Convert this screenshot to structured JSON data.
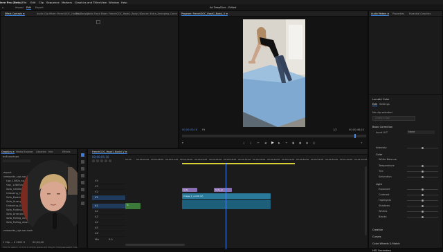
{
  "menubar": {
    "app_title": "iere Pro (Beta)",
    "items": [
      "File",
      "Edit",
      "Clip",
      "Sequence",
      "Markers",
      "Graphics and Titles",
      "View",
      "Window",
      "Help"
    ]
  },
  "appbar": {
    "import": "Import",
    "edit": "Edit",
    "export": "Export",
    "project_title": "Ad DeepDive - Edited"
  },
  "source_tabs": [
    "Effect Controls ≡",
    "Audio Clip Mixer: FrenchGOC_Hook1_Bodyl_V",
    "Text",
    "Audio Track Mixer: FrenchGOC_Hook1_Bodyl_V",
    "Source: Extra_Arranging_Conm"
  ],
  "program": {
    "tab": "Program: FrenchGOC_Hook1_Bodyl_V ≡",
    "timecode_left": "00;00;05;16",
    "fit": "Fit",
    "timecode_right": "00;00;48;14",
    "ratio": "1/2"
  },
  "right_tabs": [
    "Audio Meters ≡",
    "Properties",
    "Essential Graphics"
  ],
  "lumetri": {
    "heading": "Lumetri Color",
    "tabs": [
      "Edit",
      "Settings"
    ],
    "no_clip": "No clip selected",
    "create_look": "Create a look",
    "section_basic": "Basic Correction",
    "input_lut": "Input LUT",
    "input_lut_value": "None",
    "intensity": "Intensity",
    "color": "Color",
    "white_balance": "White Balance",
    "temperature": "Temperature",
    "tint": "Tint",
    "saturation": "Saturation",
    "light": "Light",
    "light_rows": [
      "Exposure",
      "Contrast",
      "Highlights",
      "Shadows",
      "Whites",
      "Blacks"
    ],
    "sections": [
      "Creative",
      "Curves",
      "Color Wheels & Match",
      "HSL Secondary"
    ]
  },
  "project_panel": {
    "tabs": [
      "Graphics ≡",
      "Media Browser",
      "Libraries",
      "Info",
      "Effects"
    ],
    "project_name": "ex4hoostapo",
    "items": [
      "export",
      "removebr_ugc-sar-inwh",
      "Ugc_1080x_sp",
      "Vwc_1080Serv",
      "Sofa_1080Serv",
      "Unboxing_1080...",
      "Sofa_Modelon",
      "Sofa_Arranging",
      "Unboxing_Ar",
      "Sofa_Folding...",
      "Sofa_Arranging mor...",
      "Sofa_Falling_dow",
      "Sofa_Falling_down_2",
      "removebr_ugc-sar-inwh"
    ],
    "durations": [
      "",
      "",
      "",
      "",
      "",
      "",
      "",
      "",
      "",
      "",
      "",
      "",
      "",
      ""
    ],
    "footer": "Click to select, or click in empty space and drag to marquee select. Use Shift, Opt, and Cmd for other options.",
    "bottom_count": "1 Clip ... 4 2022 H",
    "duration_label": "00;04;40"
  },
  "timeline": {
    "tab": "FrenchGOC_Hook1_Bodyl_V ≡",
    "timecode": "00;00;05;16",
    "ruler": [
      "00;00",
      "00;00;04;00",
      "00;00;08;00",
      "00;00;12;00",
      "00;00;16;00",
      "00;00;20;00",
      "00;00;24;00",
      "00;00;28;00",
      "00;00;32;00",
      "00;00;36;00",
      "00;00;40;00",
      "00;00;44;00",
      "00;00;48;00",
      "00;00;52;00",
      "00;00;56;00",
      "00;01;00;00",
      "00;01;04;00"
    ],
    "video_tracks": [
      "V4",
      "V3",
      "V2",
      "V1"
    ],
    "audio_tracks": [
      "A1",
      "A2",
      "A3",
      "A4",
      "A5",
      "A6"
    ],
    "clips": {
      "v3_a": "Sofa",
      "v3_b": "Sofa_Ar",
      "v2_main": "Image_1_uniCR (V)",
      "a_green": "fx"
    },
    "mix": "Mix",
    "mix_value": "0.0"
  }
}
